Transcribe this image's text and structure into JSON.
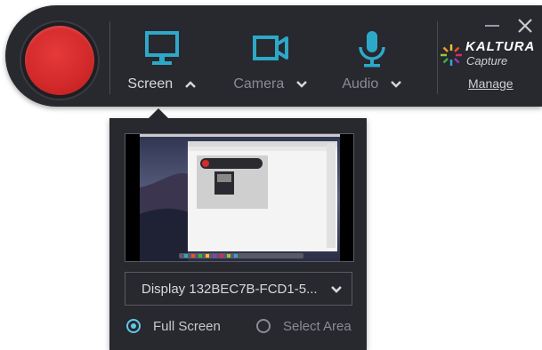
{
  "toolbar": {
    "sources": [
      {
        "label": "Screen",
        "icon": "monitor-icon",
        "state": "active",
        "caret": "chevron-up-icon"
      },
      {
        "label": "Camera",
        "icon": "video-camera-icon",
        "state": "inactive",
        "caret": "chevron-down-icon"
      },
      {
        "label": "Audio",
        "icon": "microphone-icon",
        "state": "inactive",
        "caret": "chevron-down-icon"
      }
    ],
    "window_controls": {
      "minimize": "minimize-icon",
      "close": "close-icon"
    },
    "brand": {
      "name": "KALTURA",
      "sub": "Capture"
    },
    "manage_label": "Manage"
  },
  "screen_panel": {
    "display_value": "Display 132BEC7B-FCD1-5...",
    "options": [
      {
        "label": "Full Screen",
        "checked": true
      },
      {
        "label": "Select Area",
        "checked": false
      }
    ]
  },
  "colors": {
    "background": "#28282f",
    "accent": "#2ea8c9",
    "record": "#d42a2b",
    "radio_selected": "#5fc8e8"
  }
}
